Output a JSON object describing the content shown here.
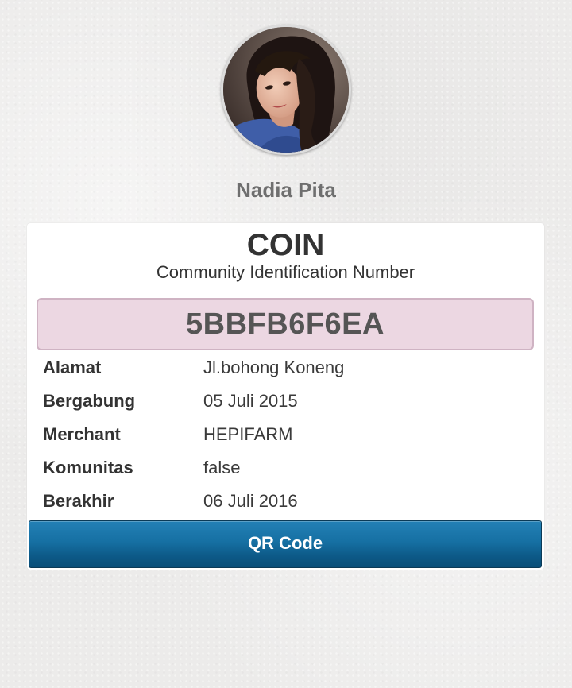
{
  "profile": {
    "name": "Nadia Pita",
    "avatar_icon": "user-photo"
  },
  "card": {
    "title": "COIN",
    "subtitle": "Community Identification Number",
    "coin_number": "5BBFB6F6EA",
    "coin_box_color": "#ecd7e2"
  },
  "details": [
    {
      "label": "Alamat",
      "value": "Jl.bohong Koneng"
    },
    {
      "label": "Bergabung",
      "value": "05 Juli 2015"
    },
    {
      "label": "Merchant",
      "value": "HEPIFARM"
    },
    {
      "label": "Komunitas",
      "value": "false"
    },
    {
      "label": "Berakhir",
      "value": "06 Juli 2016"
    }
  ],
  "actions": {
    "qr_button_label": "QR Code",
    "qr_button_color": "#1670a3"
  }
}
